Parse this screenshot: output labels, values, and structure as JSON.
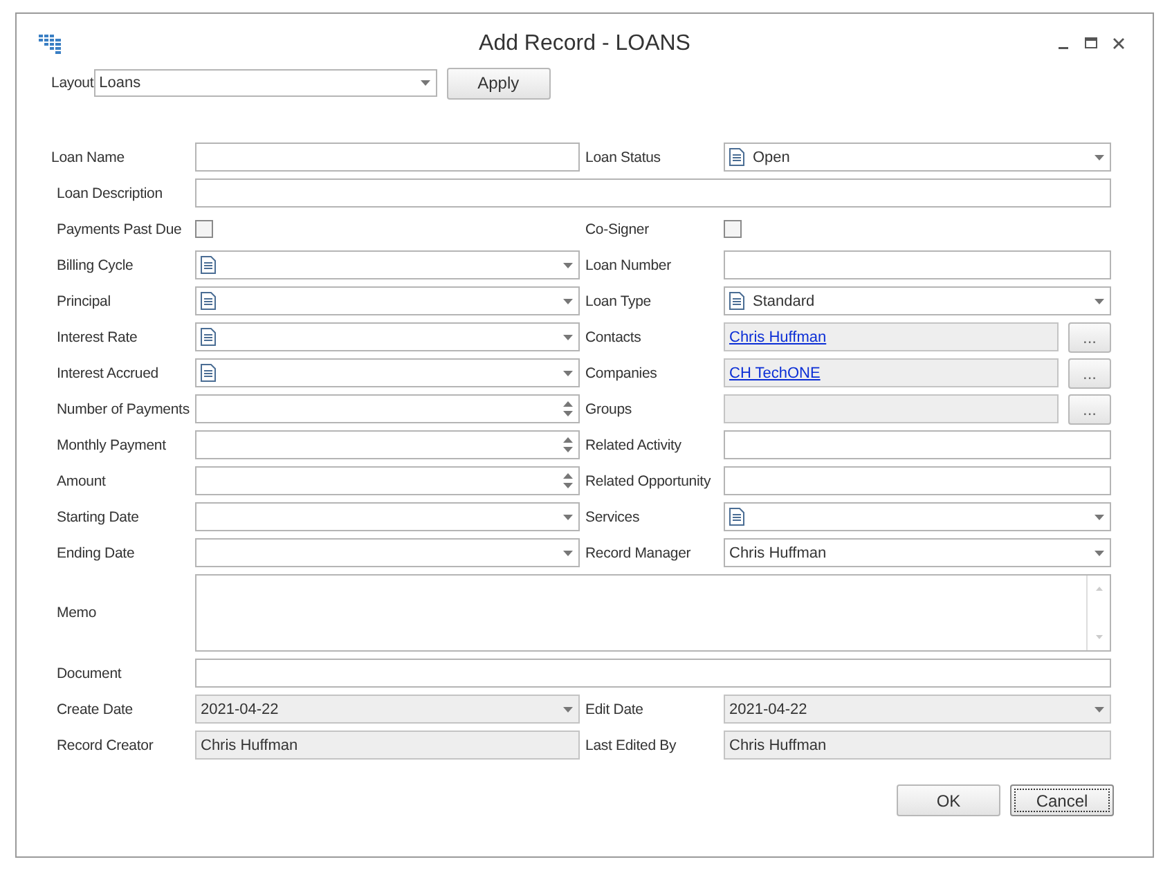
{
  "window": {
    "title": "Add Record - LOANS"
  },
  "layout": {
    "label": "Layout",
    "value": "Loans",
    "apply": "Apply"
  },
  "rows": [
    {
      "cells": [
        {
          "label": "Loan Name",
          "kind": "text",
          "disabled": false
        },
        {
          "label": "Loan Status",
          "kind": "lookup",
          "value": "Open",
          "disabled": false
        }
      ]
    },
    {
      "cells": [
        {
          "label": "Loan Description",
          "kind": "text",
          "disabled": false
        }
      ]
    },
    {
      "cells": [
        {
          "label": "Payments Past Due",
          "kind": "check",
          "checked": false,
          "disabled": false
        },
        {
          "label": "Co-Signer",
          "kind": "check",
          "checked": false,
          "disabled": false
        }
      ]
    },
    {
      "cells": [
        {
          "label": "Billing Cycle",
          "kind": "lookup",
          "disabled": false
        },
        {
          "label": "Loan Number",
          "kind": "text",
          "disabled": false
        }
      ]
    },
    {
      "cells": [
        {
          "label": "Principal",
          "kind": "lookup",
          "disabled": false
        },
        {
          "label": "Loan Type",
          "kind": "lookup",
          "value": "Standard",
          "disabled": false
        }
      ]
    },
    {
      "cells": [
        {
          "label": "Interest Rate",
          "kind": "lookup",
          "disabled": false
        },
        {
          "label": "Contacts",
          "kind": "link",
          "value": "Chris Huffman",
          "button": "...",
          "disabled": true
        }
      ]
    },
    {
      "cells": [
        {
          "label": "Interest Accrued",
          "kind": "lookup",
          "disabled": false
        },
        {
          "label": "Companies",
          "kind": "link",
          "value": "CH TechONE",
          "button": "...",
          "disabled": true
        }
      ]
    },
    {
      "cells": [
        {
          "label": "Number of Payments",
          "kind": "spin",
          "disabled": false
        },
        {
          "label": "Groups",
          "kind": "link",
          "button": "...",
          "disabled": true
        }
      ]
    },
    {
      "cells": [
        {
          "label": "Monthly Payment",
          "kind": "spin",
          "disabled": false
        },
        {
          "label": "Related Activity",
          "kind": "text",
          "disabled": false
        }
      ]
    },
    {
      "cells": [
        {
          "label": "Amount",
          "kind": "spin",
          "disabled": false
        },
        {
          "label": "Related Opportunity",
          "kind": "text",
          "disabled": false
        }
      ]
    },
    {
      "cells": [
        {
          "label": "Starting Date",
          "kind": "combo",
          "disabled": false
        },
        {
          "label": "Services",
          "kind": "lookup",
          "disabled": false
        }
      ]
    },
    {
      "cells": [
        {
          "label": "Ending Date",
          "kind": "combo",
          "disabled": false
        },
        {
          "label": "Record Manager",
          "kind": "combo",
          "value": "Chris Huffman",
          "disabled": false
        }
      ]
    },
    {
      "cells": [
        {
          "label": "Memo",
          "kind": "memo",
          "disabled": false
        }
      ]
    },
    {
      "cells": [
        {
          "label": "Document",
          "kind": "text",
          "disabled": false
        }
      ]
    },
    {
      "cells": [
        {
          "label": "Create Date",
          "kind": "combo",
          "value": "2021-04-22",
          "disabled": true
        },
        {
          "label": "Edit Date",
          "kind": "combo",
          "value": "2021-04-22",
          "disabled": true
        }
      ]
    },
    {
      "cells": [
        {
          "label": "Record Creator",
          "kind": "text",
          "value": "Chris Huffman",
          "disabled": true
        },
        {
          "label": "Last Edited By",
          "kind": "text",
          "value": "Chris Huffman",
          "disabled": true
        }
      ]
    }
  ],
  "buttons": [
    {
      "label": "OK",
      "focused": false
    },
    {
      "label": "Cancel",
      "focused": true
    }
  ]
}
